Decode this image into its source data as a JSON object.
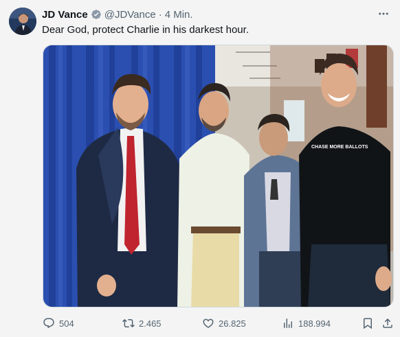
{
  "tweet": {
    "author_name": "JD Vance",
    "handle": "@JDVance",
    "separator": "·",
    "time": "4 Min.",
    "text": "Dear God, protect Charlie in his darkest hour.",
    "media": {
      "shirt_text": "CHASE MORE BALLOTS"
    },
    "stats": {
      "replies": "504",
      "reposts": "2.465",
      "likes": "26.825",
      "views": "188.994"
    },
    "colors": {
      "verified": "#1d9bf0",
      "secondary_text": "#536471"
    }
  }
}
